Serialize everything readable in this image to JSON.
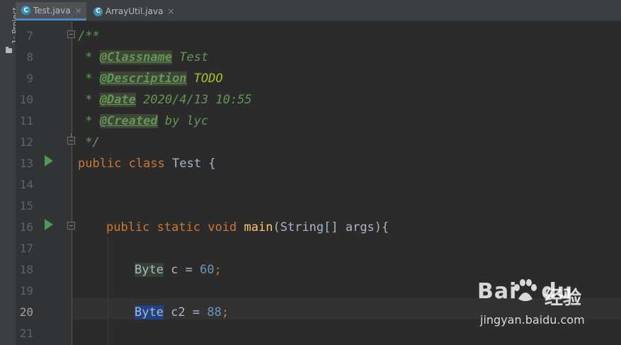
{
  "sidebar": {
    "project_label": "1: Project"
  },
  "tabs": [
    {
      "label": "Test.java",
      "close": "×",
      "icon": "java-class-icon"
    },
    {
      "label": "ArrayUtil.java",
      "close": "×",
      "icon": "java-class-icon"
    }
  ],
  "line_numbers": [
    "7",
    "8",
    "9",
    "10",
    "11",
    "12",
    "13",
    "14",
    "15",
    "16",
    "17",
    "18",
    "19",
    "20",
    "21"
  ],
  "current_line": "20",
  "code": {
    "l7": "/**",
    "l8": {
      "star": " * ",
      "tag": "@Classname",
      "text": " Test"
    },
    "l9": {
      "star": " * ",
      "tag": "@Description",
      "text": " ",
      "todo": "TODO"
    },
    "l10": {
      "star": " * ",
      "tag": "@Date",
      "text": " 2020/4/13 10:55"
    },
    "l11": {
      "star": " * ",
      "tag": "@Created",
      "text": " by lyc"
    },
    "l12": " */",
    "l13": {
      "kw1": "public",
      "kw2": "class",
      "name": "Test",
      "brace": "{"
    },
    "l16": {
      "kw1": "public",
      "kw2": "static",
      "kw3": "void",
      "fn": "main",
      "params": "(String[] args){"
    },
    "l18": {
      "type": "Byte",
      "rest": " c = ",
      "num": "60",
      "semi": ";"
    },
    "l20": {
      "type": "Byte",
      "rest": " c2 = ",
      "num": "88",
      "semi": ";"
    }
  },
  "watermark": {
    "logo_left": "Bai",
    "logo_right": "du",
    "cn": "经验",
    "url": "jingyan.baidu.com"
  }
}
